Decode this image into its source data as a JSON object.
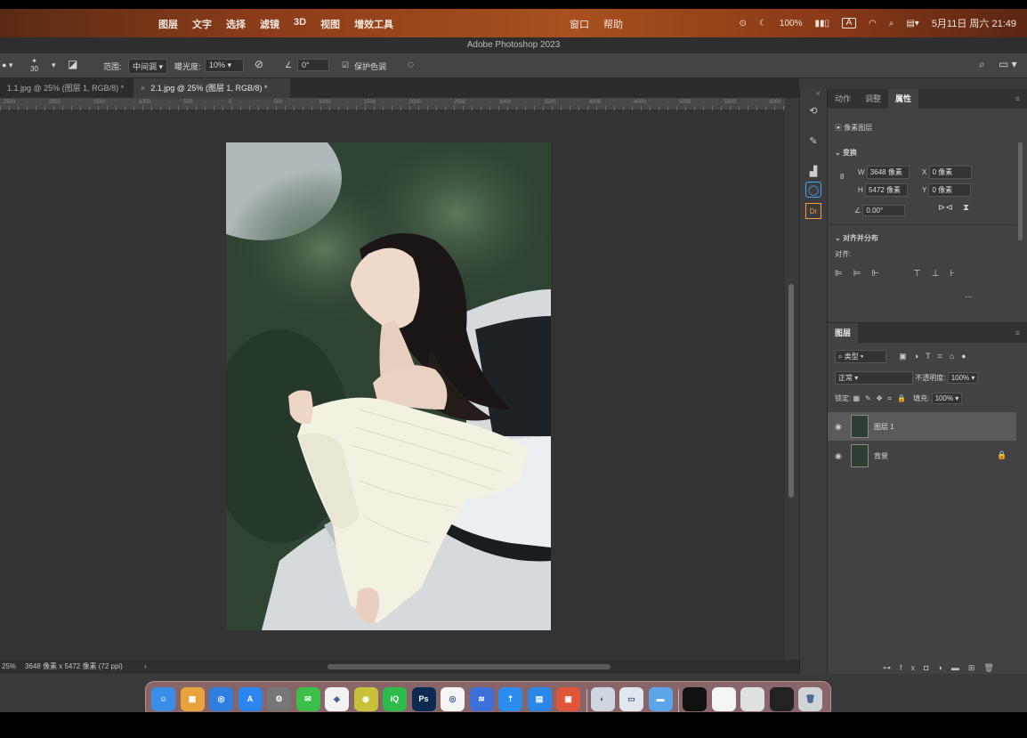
{
  "menubar": {
    "menus": [
      "图层",
      "文字",
      "选择",
      "滤镜",
      "3D",
      "视图",
      "增效工具"
    ],
    "menus_right": [
      "窗口",
      "帮助"
    ],
    "battery": "100%",
    "input_method": "A",
    "datetime": "5月11日 周六 21:49"
  },
  "window": {
    "title": "Adobe Photoshop 2023"
  },
  "options_bar": {
    "size_value": "30",
    "range_label": "范围:",
    "range_value": "中间调",
    "exposure_label": "曝光度:",
    "exposure_value": "10%",
    "angle_value": "0°",
    "protect_tones_label": "保护色调"
  },
  "tabs": [
    {
      "label": "1.1.jpg @ 25% (图层 1, RGB/8) *"
    },
    {
      "label": "2.1.jpg @ 25% (图层 1, RGB/8) *"
    }
  ],
  "ruler_labels": [
    "2500",
    "2000",
    "1500",
    "1000",
    "500",
    "0",
    "500",
    "1000",
    "1500",
    "2000",
    "2500",
    "3000",
    "3500",
    "4000",
    "4500",
    "5000",
    "5500",
    "6000"
  ],
  "status_bar": {
    "zoom": "25%",
    "doc_info": "3648 像素 x 5472 像素 (72 ppi)"
  },
  "properties_panel": {
    "tabs": [
      "动作",
      "调整",
      "属性"
    ],
    "layer_type": "像素图层",
    "transform_label": "变换",
    "w_label": "W",
    "w_value": "3648 像素",
    "x_label": "X",
    "x_value": "0 像素",
    "h_label": "H",
    "h_value": "5472 像素",
    "y_label": "Y",
    "y_value": "0 像素",
    "angle_value": "0.00°",
    "align_section": "对齐并分布",
    "align_label": "对齐:",
    "more": "..."
  },
  "layers_panel": {
    "tab": "图层",
    "filter_label": "类型",
    "blend_mode": "正常",
    "opacity_label": "不透明度:",
    "opacity_value": "100%",
    "lock_label": "锁定:",
    "fill_label": "填充:",
    "fill_value": "100%",
    "layers": [
      {
        "name": "图层 1",
        "selected": true
      },
      {
        "name": "背景",
        "selected": false
      }
    ]
  },
  "dock": {
    "apps": [
      {
        "name": "finder",
        "color": "#3b8ee8",
        "glyph": "☺"
      },
      {
        "name": "launchpad",
        "color": "#e8a33b",
        "glyph": "▦"
      },
      {
        "name": "safari",
        "color": "#2f7fe0",
        "glyph": "◎"
      },
      {
        "name": "app-store",
        "color": "#2b86f0",
        "glyph": "A"
      },
      {
        "name": "system-settings",
        "color": "#777",
        "glyph": "⚙"
      },
      {
        "name": "wechat",
        "color": "#3cbf4a",
        "glyph": "✉"
      },
      {
        "name": "baidu-netdisk",
        "color": "#f2f2f2",
        "glyph": "◈"
      },
      {
        "name": "app-yellow",
        "color": "#c8c23a",
        "glyph": "◉"
      },
      {
        "name": "iqiyi",
        "color": "#2dbb4a",
        "glyph": "iQ"
      },
      {
        "name": "photoshop",
        "color": "#0b2a52",
        "glyph": "Ps"
      },
      {
        "name": "app-blue-ring",
        "color": "#f4f4f4",
        "glyph": "◎"
      },
      {
        "name": "app-feishu",
        "color": "#3d6fd8",
        "glyph": "≋"
      },
      {
        "name": "app-arrow",
        "color": "#2b8cf0",
        "glyph": "⇡"
      },
      {
        "name": "keynote",
        "color": "#2b88e8",
        "glyph": "▤"
      },
      {
        "name": "app-red",
        "color": "#e0553a",
        "glyph": "▣"
      },
      {
        "name": "preview",
        "color": "#cfd6e0",
        "glyph": "◐"
      },
      {
        "name": "app-screens",
        "color": "#dfe6ee",
        "glyph": "▭"
      },
      {
        "name": "folder",
        "color": "#5aa6e8",
        "glyph": "▬"
      },
      {
        "name": "window-1",
        "color": "#111",
        "glyph": ""
      },
      {
        "name": "window-2",
        "color": "#f4f4f4",
        "glyph": ""
      },
      {
        "name": "window-3",
        "color": "#e0e0e0",
        "glyph": ""
      },
      {
        "name": "window-4",
        "color": "#222",
        "glyph": ""
      },
      {
        "name": "trash",
        "color": "#cfd4d8",
        "glyph": "🗑"
      }
    ]
  }
}
